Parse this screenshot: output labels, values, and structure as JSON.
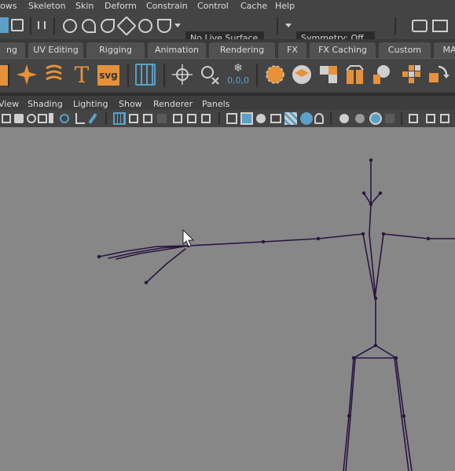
{
  "menubar": {
    "items": [
      "ows",
      "Skeleton",
      "Skin",
      "Deform",
      "Constrain",
      "Control",
      "Cache",
      "Help"
    ]
  },
  "statusline": {
    "live_surface": "No Live Surface",
    "symmetry": "Symmetry: Off"
  },
  "shelf_tabs": [
    "ng",
    "UV Editing",
    "Rigging",
    "Animation",
    "Rendering",
    "FX",
    "FX Caching",
    "Custom",
    "MA"
  ],
  "shelf": {
    "text_icon": "T",
    "svg_icon": "svg",
    "coords": "0,0,0"
  },
  "panel_menu": [
    "View",
    "Shading",
    "Lighting",
    "Show",
    "Renderer",
    "Panels"
  ],
  "colors": {
    "menubar_bg": "#444444",
    "shelf_bg": "#444444",
    "viewport_bg": "#878787",
    "active_tab": "#5d5d5d",
    "highlight_blue": "#5aa0c8",
    "skeleton": "#2a1542",
    "shelf_orange": "#e7913b"
  }
}
